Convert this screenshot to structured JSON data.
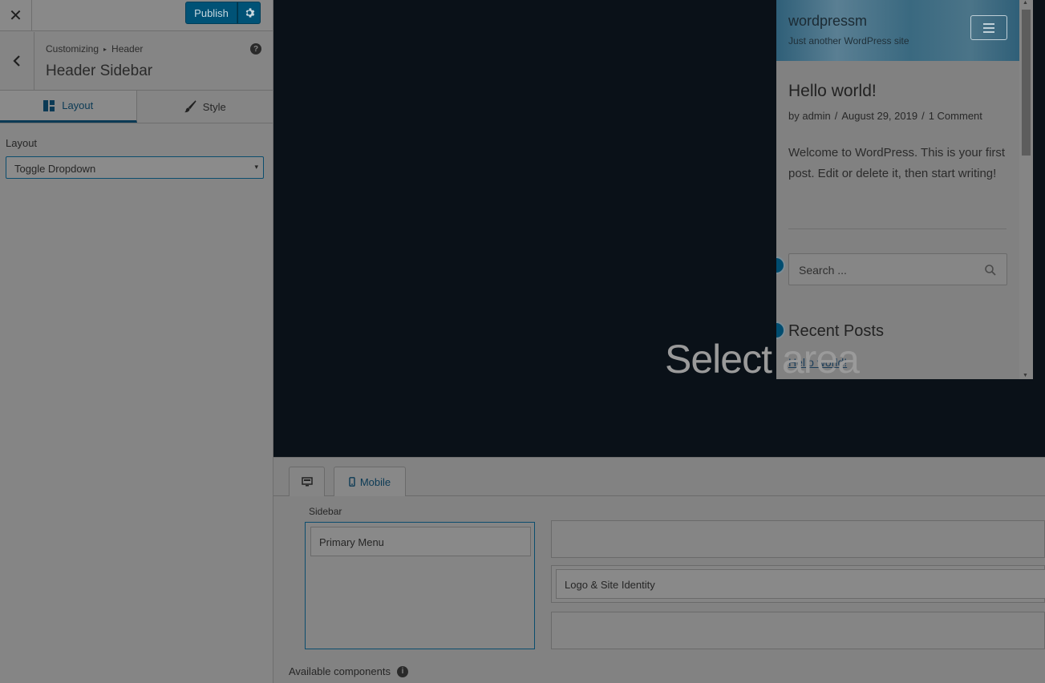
{
  "topbar": {
    "close_glyph": "✕",
    "publish_label": "Publish",
    "settings_icon": "gear-icon"
  },
  "section": {
    "breadcrumb_root": "Customizing",
    "breadcrumb_separator": "▸",
    "breadcrumb_parent": "Header",
    "title": "Header Sidebar",
    "help_glyph": "?"
  },
  "tabs": [
    {
      "label": "Layout",
      "icon": "layout-icon",
      "active": true
    },
    {
      "label": "Style",
      "icon": "brush-icon",
      "active": false
    }
  ],
  "layout_field": {
    "label": "Layout",
    "selected": "Toggle Dropdown",
    "arrow": "▾"
  },
  "preview": {
    "site_title": "wordpressm",
    "site_tagline": "Just another WordPress site",
    "post": {
      "title": "Hello world!",
      "meta_by": "by admin",
      "meta_date": "August 29, 2019",
      "meta_comments": "1 Comment",
      "meta_separator": "/",
      "body": "Welcome to WordPress. This is your first post. Edit or delete it, then start writing!"
    },
    "search_placeholder": "Search ...",
    "widget_title": "Recent Posts",
    "widget_link": "Hello world!",
    "overlay_text": "Select area",
    "scroll_up": "▲",
    "scroll_down": "▼"
  },
  "builder": {
    "device_tabs": [
      {
        "label": "",
        "icon": "desktop-icon",
        "active": false
      },
      {
        "label": "Mobile",
        "icon": "mobile-icon",
        "active": true
      }
    ],
    "sidebar_label": "Sidebar",
    "sidebar_items": [
      "Primary Menu"
    ],
    "row_items": [
      "Logo & Site Identity"
    ],
    "available_label": "Available components",
    "info_glyph": "i"
  },
  "colors": {
    "accent": "#0b3a55",
    "publish_bg": "#005276",
    "preview_bg": "#0a1118"
  }
}
